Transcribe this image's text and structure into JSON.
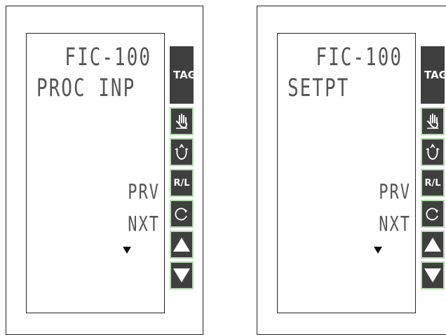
{
  "panels": [
    {
      "tag": "FIC-100",
      "parameter": "PROC INP",
      "prev_label": "PRV",
      "next_label": "NXT",
      "keys": {
        "tag": "TAG",
        "rl": "R/L"
      }
    },
    {
      "tag": "FIC-100",
      "parameter": "SETPT",
      "prev_label": "PRV",
      "next_label": "NXT",
      "keys": {
        "tag": "TAG",
        "rl": "R/L"
      }
    }
  ],
  "icons": {
    "manual": "hand-icon",
    "auto": "auto-mode-icon",
    "cycle": "cycle-icon",
    "up": "up-arrow-icon",
    "down": "down-arrow-icon",
    "more": "down-triangle-icon"
  },
  "colors": {
    "key_fill": "#3f3f3f",
    "key_border": "#b6dcb0",
    "lcd_text": "#555555"
  }
}
